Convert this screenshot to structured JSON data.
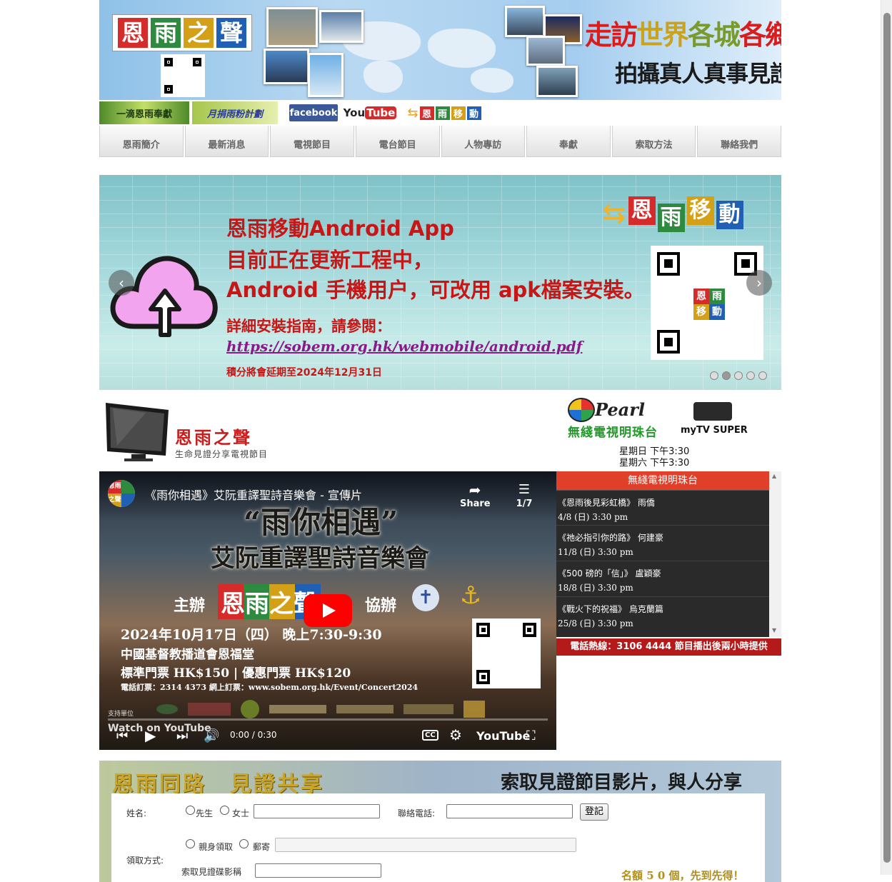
{
  "header": {
    "logo_chars": [
      "恩",
      "雨",
      "之",
      "聲"
    ],
    "logo_colors": [
      "#d62b2b",
      "#2d8a3e",
      "#d4a017",
      "#1f5fb4"
    ],
    "slogan_line1": [
      "走訪",
      "世界",
      "各城",
      "各鄉"
    ],
    "slogan_line2": "拍攝真人真事見證"
  },
  "links": {
    "donate": "一滴恩雨奉獻",
    "monthly": "月捐雨粉計劃",
    "facebook": "facebook",
    "youtube_you": "You",
    "youtube_tube": "Tube",
    "mobile_chars": [
      "恩",
      "雨",
      "移",
      "動"
    ]
  },
  "nav": [
    "恩雨簡介",
    "最新消息",
    "電視節目",
    "電台節目",
    "人物專訪",
    "奉獻",
    "索取方法",
    "聯絡我們"
  ],
  "slider": {
    "line1": "恩雨移動Android App",
    "line2": "目前正在更新工程中，",
    "line3": "Android 手機用户，可改用 apk檔案安裝。",
    "guide": "詳細安裝指南，請參閱：",
    "url": "https://sobem.org.hk/webmobile/android.pdf",
    "points": "積分將會延期至2024年12月31日",
    "brand_chars": [
      "恩",
      "雨",
      "移",
      "動"
    ],
    "prev": "‹",
    "next": "›",
    "active_slide": 2
  },
  "tv": {
    "title": "恩雨之聲",
    "subtitle": "生命見證分享電視節目",
    "channel": "無綫電視明珠台",
    "pearl_script": "Pearl",
    "mytv": "myTV SUPER",
    "time1": "星期日 下午3:30",
    "time2": "星期六 下午3:30"
  },
  "video": {
    "channel_badge": [
      "恩雨",
      "之聲"
    ],
    "title": "《雨你相遇》艾阮重譯聖詩音樂會 - 宣傳片",
    "share": "Share",
    "playlist": "1/7",
    "poster_title": "“雨你相遇”",
    "poster_sub": "艾阮重譯聖詩音樂會",
    "host": "主辦",
    "cohost": "協辦",
    "host_brand": "恩雨之聲",
    "date": "2024年10月17日（四） 晚上7:30-9:30",
    "venue": "中國基督教播道會恩福堂",
    "price": "標準門票 HK$150 | 優惠門票 HK$120",
    "booking": "電話訂票：2314 4373  網上訂票：www.sobem.org.hk/Event/Concert2024",
    "supporters": "支持單位",
    "watch_on": "Watch on",
    "youtube": "YouTube",
    "time": "0:00 / 0:30",
    "progress": 0.0
  },
  "schedule": {
    "header": "無綫電視明珠台",
    "items": [
      {
        "title": "《恩雨後見彩虹橋》 雨僑",
        "time": "4/8 (日) 3:30 pm"
      },
      {
        "title": "《祂必指引你的路》 何建豪",
        "time": "11/8 (日) 3:30 pm"
      },
      {
        "title": "《500 磅的「信」》 盧穎豪",
        "time": "18/8 (日) 3:30 pm"
      },
      {
        "title": "《戰火下的祝福》 烏克蘭篇",
        "time": "25/8 (日) 3:30 pm"
      }
    ],
    "hotline": "電話熱線：3106 4444  節目播出後兩小時提供"
  },
  "form": {
    "banner_left": "恩雨同路　見證共享",
    "banner_right": "索取見證節目影片，與人分享",
    "name_label": "姓名:",
    "mr": "先生",
    "ms": "女士",
    "phone_label": "聯絡電話:",
    "login": "登記",
    "method_label": "領取方式:",
    "pickup": "親身領取",
    "mail": "郵寄",
    "disc_label": "索取見證碟影稱",
    "note": "名額 5 0 個，先到先得！"
  }
}
